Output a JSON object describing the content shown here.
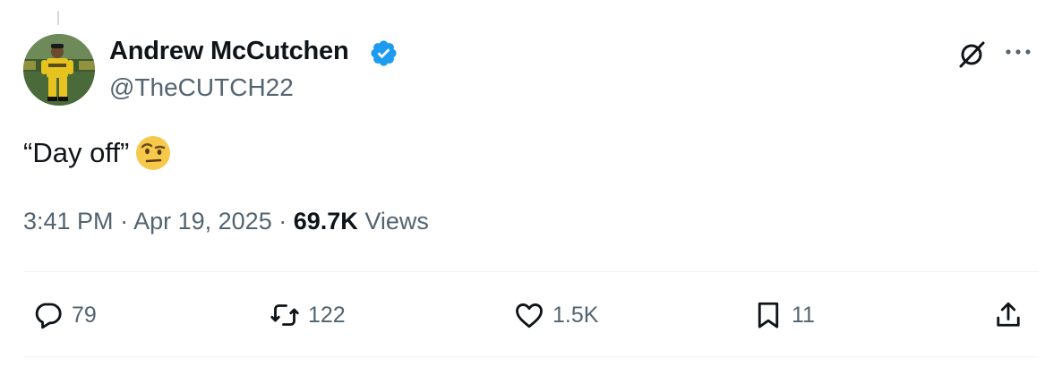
{
  "tweet": {
    "author": {
      "name": "Andrew McCutchen",
      "handle": "@TheCUTCH22",
      "verified": true
    },
    "text": "“Day off”",
    "emoji": "face-with-raised-eyebrow",
    "time": "3:41 PM",
    "date": "Apr 19, 2025",
    "separator": "·",
    "views_count": "69.7K",
    "views_label": "Views"
  },
  "actions": {
    "replies": "79",
    "reposts": "122",
    "likes": "1.5K",
    "bookmarks": "11"
  },
  "colors": {
    "text_primary": "#0f1419",
    "text_secondary": "#536471",
    "verified_blue": "#1d9bf0",
    "divider": "#eff3f4"
  },
  "icons": [
    "grok-icon",
    "more-icon",
    "reply-icon",
    "repost-icon",
    "like-icon",
    "bookmark-icon",
    "share-icon"
  ]
}
